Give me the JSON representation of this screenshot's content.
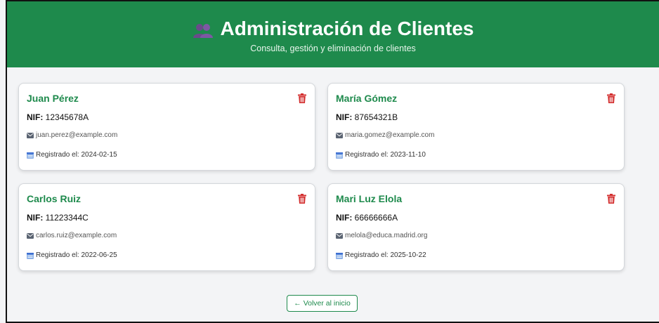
{
  "header": {
    "title": "Administración de Clientes",
    "subtitle": "Consulta, gestión y eliminación de clientes",
    "icon": "people-icon"
  },
  "nif_label": "NIF:",
  "clients": [
    {
      "name": "Juan Pérez",
      "nif": "12345678A",
      "email": "juan.perez@example.com",
      "registered": "Registrado el: 2024-02-15"
    },
    {
      "name": "María Gómez",
      "nif": "87654321B",
      "email": "maria.gomez@example.com",
      "registered": "Registrado el: 2023-11-10"
    },
    {
      "name": "Carlos Ruiz",
      "nif": "11223344C",
      "email": "carlos.ruiz@example.com",
      "registered": "Registrado el: 2022-06-25"
    },
    {
      "name": "Mari Luz Elola",
      "nif": "66666666A",
      "email": "melola@educa.madrid.org",
      "registered": "Registrado el: 2025-10-22"
    }
  ],
  "back_button": {
    "label": "Volver al inicio",
    "arrow": "←"
  },
  "colors": {
    "brand": "#1e8a4c",
    "delete": "#d32f2f"
  }
}
